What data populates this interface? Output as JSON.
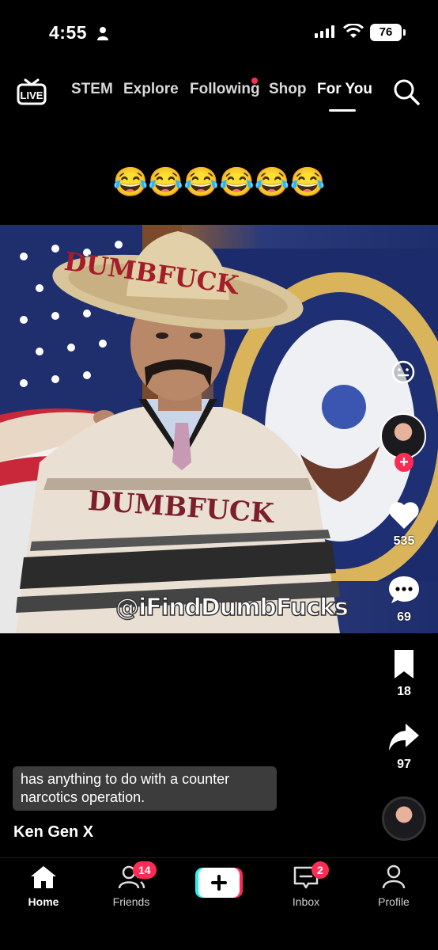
{
  "status_bar": {
    "time": "4:55",
    "battery": "76"
  },
  "top_nav": {
    "tabs": [
      {
        "label": "STEM"
      },
      {
        "label": "Explore"
      },
      {
        "label": "Following"
      },
      {
        "label": "Shop"
      },
      {
        "label": "For You"
      }
    ],
    "active_tab": "For You",
    "live_label": "LIVE"
  },
  "post": {
    "caption_emojis": "😂😂😂😂😂😂",
    "hat_text": "DUMBFUCK",
    "poncho_text": "DUMBFUCK",
    "watermark": "@iFindDumbFucks",
    "subtitle": "has anything to do with a counter narcotics operation.",
    "author": "Ken Gen X"
  },
  "actions": {
    "likes": "535",
    "comments": "69",
    "saves": "18",
    "shares": "97"
  },
  "bottom_nav": {
    "items": [
      {
        "label": "Home"
      },
      {
        "label": "Friends",
        "badge": "14"
      },
      {
        "label": ""
      },
      {
        "label": "Inbox",
        "badge": "2"
      },
      {
        "label": "Profile"
      }
    ]
  },
  "colors": {
    "accent": "#fe2c55",
    "background": "#000000",
    "teal": "#25f4ee"
  }
}
